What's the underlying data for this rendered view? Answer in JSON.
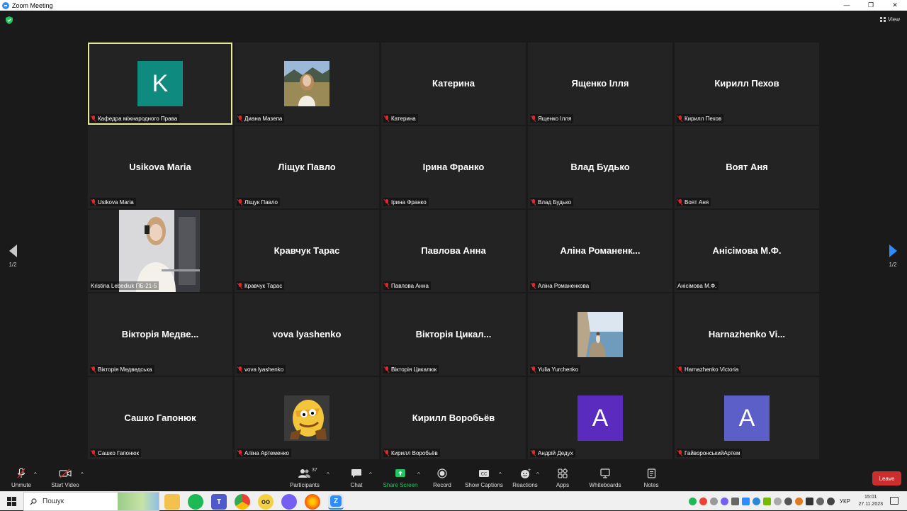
{
  "window": {
    "title": "Zoom Meeting",
    "controls": [
      "—",
      "❐",
      "✕"
    ]
  },
  "view": {
    "label": "View"
  },
  "pages": {
    "left": "1/2",
    "right": "1/2"
  },
  "participants_grid": [
    {
      "big": "",
      "label": "Кафедра міжнародного Права",
      "avatar": "K",
      "avatar_color": "#0f8a7e",
      "active": true
    },
    {
      "big": "",
      "label": "Диана Мазепа",
      "photo": "woman-field"
    },
    {
      "big": "Катерина",
      "label": "Катерина"
    },
    {
      "big": "Ященко Ілля",
      "label": "Ященко Ілля"
    },
    {
      "big": "Кирилл Пехов",
      "label": "Кирилл Пехов"
    },
    {
      "big": "Usikova Maria",
      "label": "Usikova Maria"
    },
    {
      "big": "Ліщук Павло",
      "label": "Ліщук Павло"
    },
    {
      "big": "Ірина Франко",
      "label": "Ірина Франко"
    },
    {
      "big": "Влад Будько",
      "label": "Влад Будько"
    },
    {
      "big": "Воят Аня",
      "label": "Воят Аня"
    },
    {
      "big": "",
      "label": "Kristina Lebediuk ПБ-21-5",
      "photo": "woman-mirror",
      "no_mic": true
    },
    {
      "big": "Кравчук Тарас",
      "label": "Кравчук Тарас"
    },
    {
      "big": "Павлова Анна",
      "label": "Павлова Анна"
    },
    {
      "big": "Аліна Романенк...",
      "label": "Аліна Романенкова"
    },
    {
      "big": "Анісімова М.Ф.",
      "label": "Анісімова М.Ф.",
      "no_mic": true
    },
    {
      "big": "Вікторія Медве...",
      "label": "Вікторія Медведська"
    },
    {
      "big": "vova lyashenko",
      "label": "vova lyashenko"
    },
    {
      "big": "Вікторія Цикал...",
      "label": "Вікторія Цикалюк"
    },
    {
      "big": "",
      "label": "Yulia Yurchenko",
      "photo": "sea-rocks"
    },
    {
      "big": "Harnazhenko Vi...",
      "label": "Harnazhenko Victoria"
    },
    {
      "big": "Сашко Гапонюк",
      "label": "Сашко Гапонюк"
    },
    {
      "big": "",
      "label": "Аліна Артеменко",
      "photo": "caveman-meme"
    },
    {
      "big": "Кирилл Воробьёв",
      "label": "Кирилл Воробьёв"
    },
    {
      "big": "",
      "label": "Андрій Дедух",
      "avatar": "A",
      "avatar_color": "#5b2bbf"
    },
    {
      "big": "",
      "label": "ГайворонськийАртем",
      "avatar": "A",
      "avatar_color": "#5b5fc7"
    }
  ],
  "toolbar": {
    "unmute": "Unmute",
    "start_video": "Start Video",
    "participants": "Participants",
    "participants_count": "37",
    "chat": "Chat",
    "share_screen": "Share Screen",
    "record": "Record",
    "show_captions": "Show Captions",
    "reactions": "Reactions",
    "apps": "Apps",
    "whiteboards": "Whiteboards",
    "notes": "Notes",
    "leave": "Leave"
  },
  "taskbar": {
    "search_placeholder": "Пошук",
    "language": "УКР",
    "time": "15:01",
    "date": "27.11.2023"
  },
  "colors": {
    "accent": "#2d8cff",
    "leave": "#cc2d2d",
    "share": "#22c55e",
    "active_border": "#e6e89a",
    "muted": "#e02828"
  }
}
